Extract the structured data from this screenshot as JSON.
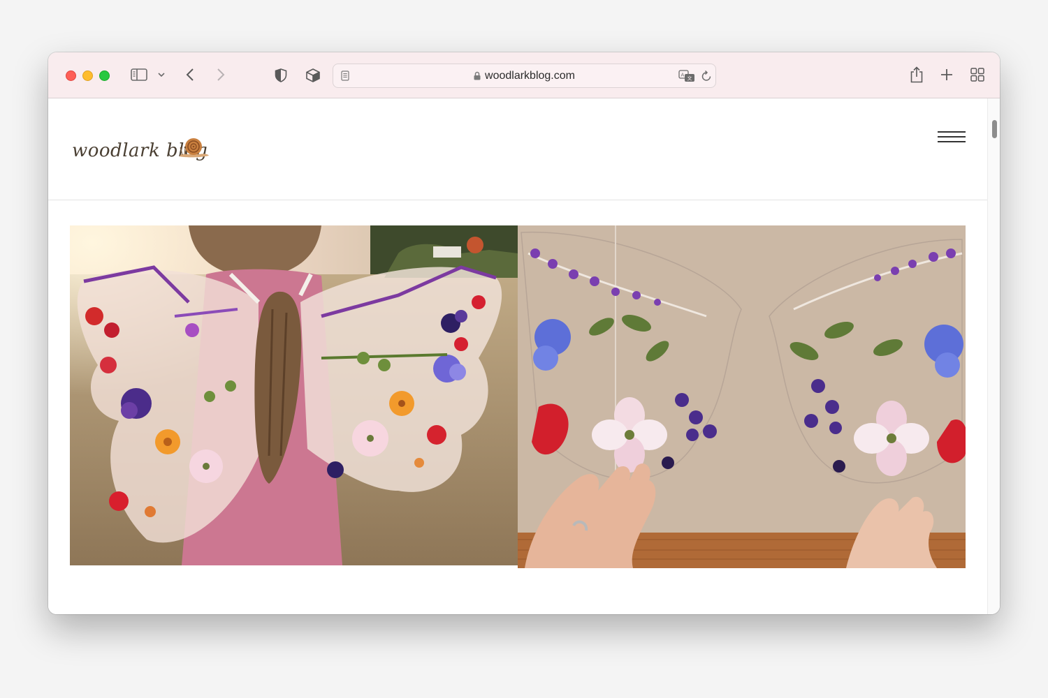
{
  "browser": {
    "url": "woodlarkblog.com",
    "icons": [
      "sidebar-icon",
      "chevron-down-icon",
      "back-icon",
      "forward-icon",
      "privacy-shield-icon",
      "extension-box-icon",
      "reader-icon",
      "lock-icon",
      "translate-icon",
      "reload-icon",
      "share-icon",
      "plus-icon",
      "tabs-grid-icon"
    ]
  },
  "site": {
    "logo_text": "woodlark blog",
    "logo_icon": "snail-icon",
    "menu_icon": "hamburger-menu-icon"
  },
  "colors": {
    "toolbar_bg": "#f9ecee",
    "close": "#fe5f57",
    "minimize": "#febc2e",
    "zoom": "#28c840"
  }
}
